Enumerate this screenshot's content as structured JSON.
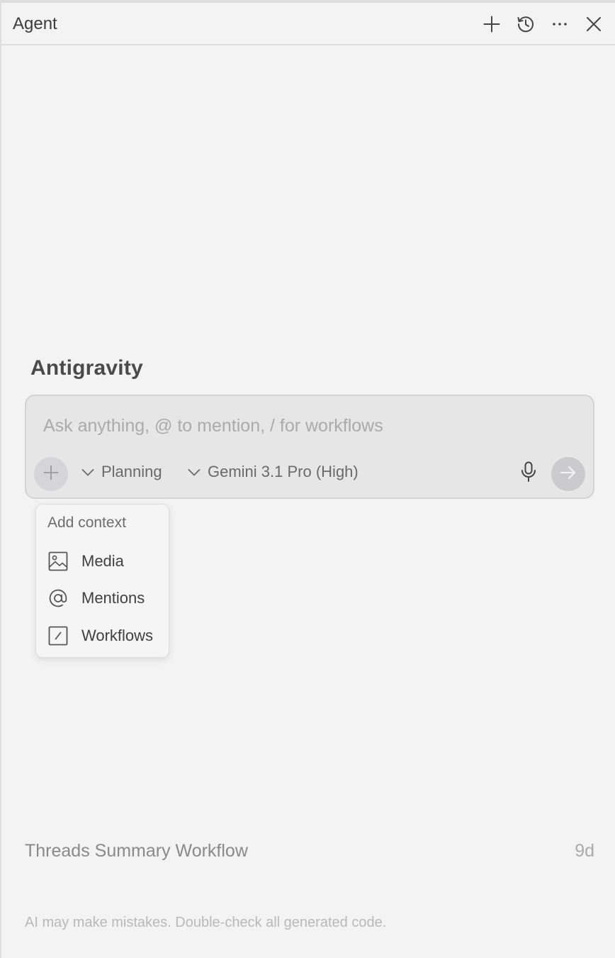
{
  "header": {
    "title": "Agent",
    "actions": [
      {
        "name": "new-chat",
        "icon": "plus-icon"
      },
      {
        "name": "history",
        "icon": "history-icon"
      },
      {
        "name": "more",
        "icon": "ellipsis-icon"
      },
      {
        "name": "close",
        "icon": "close-icon"
      }
    ]
  },
  "brand": {
    "title": "Antigravity"
  },
  "input": {
    "value": "",
    "placeholder": "Ask anything, @ to mention, / for workflows"
  },
  "toolbar": {
    "mode_label": "Planning",
    "model_label": "Gemini 3.1 Pro (High)",
    "add_icon": "plus-icon",
    "dropdown_icon": "chevron-down-icon",
    "mic_icon": "microphone-icon",
    "send_icon": "arrow-right-icon"
  },
  "context_menu": {
    "header": "Add context",
    "items": [
      {
        "label": "Media",
        "icon": "image-icon"
      },
      {
        "label": "Mentions",
        "icon": "at-sign-icon"
      },
      {
        "label": "Workflows",
        "icon": "slash-box-icon"
      }
    ]
  },
  "threads": [
    {
      "title": "Threads Summary Workflow",
      "age": "9d"
    }
  ],
  "footer": {
    "disclaimer": "AI may make mistakes. Double-check all generated code."
  },
  "colors": {
    "background": "#f3f3f3",
    "input_background": "#e6e6e7",
    "send_button": "#cbcbcd"
  }
}
